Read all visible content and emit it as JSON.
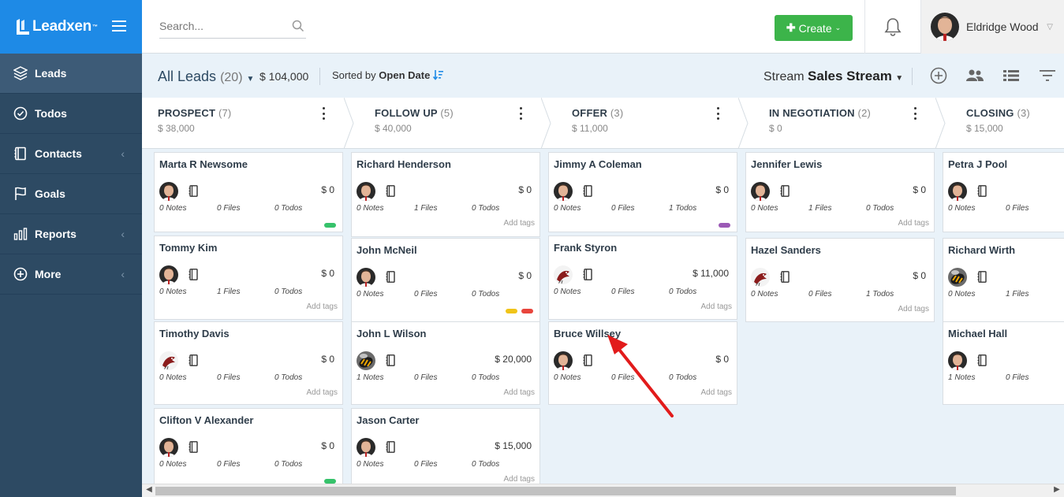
{
  "brand": {
    "name": "Leadxen",
    "tm": "™"
  },
  "sidebar": {
    "items": [
      {
        "label": "Leads",
        "icon": "layers-icon",
        "active": true,
        "chevron": false
      },
      {
        "label": "Todos",
        "icon": "check-circle-icon",
        "active": false,
        "chevron": false
      },
      {
        "label": "Contacts",
        "icon": "address-book-icon",
        "active": false,
        "chevron": true
      },
      {
        "label": "Goals",
        "icon": "flag-icon",
        "active": false,
        "chevron": false
      },
      {
        "label": "Reports",
        "icon": "bar-chart-icon",
        "active": false,
        "chevron": true
      },
      {
        "label": "More",
        "icon": "plus-circle-icon",
        "active": false,
        "chevron": true
      }
    ]
  },
  "header": {
    "search_placeholder": "Search...",
    "create_label": "Create",
    "user_name": "Eldridge Wood"
  },
  "toolbar": {
    "all_leads": "All Leads",
    "lead_count": "(20)",
    "total_value": "$ 104,000",
    "sorted_prefix": "Sorted by",
    "sorted_field": "Open Date",
    "stream_prefix": "Stream",
    "stream_name": "Sales Stream"
  },
  "stages": [
    {
      "name": "PROSPECT",
      "count": "(7)",
      "amount": "$ 38,000"
    },
    {
      "name": "FOLLOW UP",
      "count": "(5)",
      "amount": "$ 40,000"
    },
    {
      "name": "OFFER",
      "count": "(3)",
      "amount": "$ 11,000"
    },
    {
      "name": "IN NEGOTIATION",
      "count": "(2)",
      "amount": "$ 0"
    },
    {
      "name": "CLOSING",
      "count": "(3)",
      "amount": "$ 15,000"
    }
  ],
  "add_tags_label": "Add tags",
  "columns": [
    [
      {
        "name": "Marta R Newsome",
        "amount": "$ 0",
        "notes": "0 Notes",
        "files": "0 Files",
        "todos": "0 Todos",
        "avatar": "man",
        "tags": [
          "#36c26b"
        ],
        "add_tags": false
      },
      {
        "name": "Tommy Kim",
        "amount": "$ 0",
        "notes": "0 Notes",
        "files": "1 Files",
        "todos": "0 Todos",
        "avatar": "man",
        "tags": [],
        "add_tags": true
      },
      {
        "name": "Timothy Davis",
        "amount": "$ 0",
        "notes": "0 Notes",
        "files": "0 Files",
        "todos": "0 Todos",
        "avatar": "bird",
        "tags": [],
        "add_tags": true
      },
      {
        "name": "Clifton V Alexander",
        "amount": "$ 0",
        "notes": "0 Notes",
        "files": "0 Files",
        "todos": "0 Todos",
        "avatar": "man",
        "tags": [
          "#36c26b"
        ],
        "add_tags": false
      }
    ],
    [
      {
        "name": "Richard Henderson",
        "amount": "$ 0",
        "notes": "0 Notes",
        "files": "1 Files",
        "todos": "0 Todos",
        "avatar": "man",
        "tags": [],
        "add_tags": true
      },
      {
        "name": "John McNeil",
        "amount": "$ 0",
        "notes": "0 Notes",
        "files": "0 Files",
        "todos": "0 Todos",
        "avatar": "man",
        "tags": [
          "#f0c419",
          "#e8453c"
        ],
        "add_tags": false
      },
      {
        "name": "John L Wilson",
        "amount": "$ 20,000",
        "notes": "1 Notes",
        "files": "0 Files",
        "todos": "0 Todos",
        "avatar": "bee",
        "tags": [],
        "add_tags": true
      },
      {
        "name": "Jason Carter",
        "amount": "$ 15,000",
        "notes": "0 Notes",
        "files": "0 Files",
        "todos": "0 Todos",
        "avatar": "man",
        "tags": [],
        "add_tags": true
      }
    ],
    [
      {
        "name": "Jimmy A Coleman",
        "amount": "$ 0",
        "notes": "0 Notes",
        "files": "0 Files",
        "todos": "1 Todos",
        "avatar": "man",
        "tags": [
          "#9b59b6"
        ],
        "add_tags": false
      },
      {
        "name": "Frank Styron",
        "amount": "$ 11,000",
        "notes": "0 Notes",
        "files": "0 Files",
        "todos": "0 Todos",
        "avatar": "bird",
        "tags": [],
        "add_tags": true
      },
      {
        "name": "Bruce Willsey",
        "amount": "$ 0",
        "notes": "0 Notes",
        "files": "0 Files",
        "todos": "0 Todos",
        "avatar": "man",
        "tags": [],
        "add_tags": true
      }
    ],
    [
      {
        "name": "Jennifer Lewis",
        "amount": "$ 0",
        "notes": "0 Notes",
        "files": "1 Files",
        "todos": "0 Todos",
        "avatar": "man",
        "tags": [],
        "add_tags": true
      },
      {
        "name": "Hazel Sanders",
        "amount": "$ 0",
        "notes": "0 Notes",
        "files": "0 Files",
        "todos": "1 Todos",
        "avatar": "bird",
        "tags": [],
        "add_tags": true
      }
    ],
    [
      {
        "name": "Petra J Pool",
        "amount": "",
        "notes": "0 Notes",
        "files": "0 Files",
        "todos": "",
        "avatar": "man",
        "tags": [],
        "add_tags": false
      },
      {
        "name": "Richard Wirth",
        "amount": "",
        "notes": "0 Notes",
        "files": "1 Files",
        "todos": "",
        "avatar": "bee",
        "tags": [],
        "add_tags": false
      },
      {
        "name": "Michael Hall",
        "amount": "",
        "notes": "1 Notes",
        "files": "0 Files",
        "todos": "",
        "avatar": "man",
        "tags": [],
        "add_tags": false
      }
    ]
  ],
  "colors": {
    "brand_blue": "#1e8ae6",
    "sidebar_bg": "#2d4a63",
    "create_green": "#3cb44a",
    "board_bg": "#e9f2f9",
    "annotation_arrow": "#e21b1b"
  }
}
